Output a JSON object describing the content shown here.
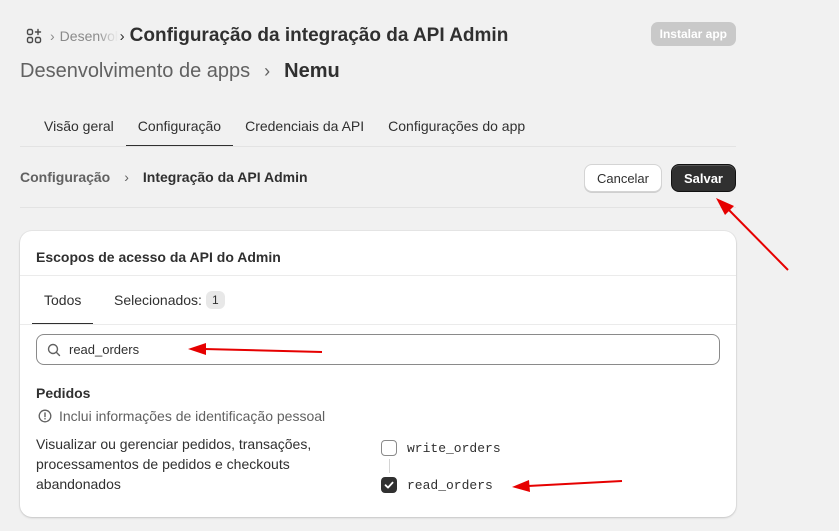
{
  "header": {
    "icon": "apps-icon",
    "breadcrumb_short": "Desenvolvimento de apps",
    "title": "Configuração da integração da API Admin",
    "install_button": "Instalar app"
  },
  "page_heading": {
    "parent": "Desenvolvimento de apps",
    "separator": "›",
    "app_name": "Nemu"
  },
  "tabs": [
    {
      "label": "Visão geral"
    },
    {
      "label": "Configuração"
    },
    {
      "label": "Credenciais da API"
    },
    {
      "label": "Configurações do app"
    }
  ],
  "subheader": {
    "section": "Configuração",
    "page": "Integração da API Admin",
    "cancel_label": "Cancelar",
    "save_label": "Salvar"
  },
  "card": {
    "title": "Escopos de acesso da API do Admin",
    "tab_all": "Todos",
    "tab_selected": "Selecionados:",
    "selected_count": "1",
    "search_value": "read_orders",
    "section_title": "Pedidos",
    "pii_notice": "Inclui informações de identificação pessoal",
    "description": "Visualizar ou gerenciar pedidos, transações, processamentos de pedidos e checkouts abandonados",
    "scopes": [
      {
        "label": "write_orders",
        "checked": false
      },
      {
        "label": "read_orders",
        "checked": true
      }
    ]
  },
  "colors": {
    "background": "#f1f1f1",
    "primary_button": "#303030",
    "annotation_arrow": "#e60000"
  }
}
